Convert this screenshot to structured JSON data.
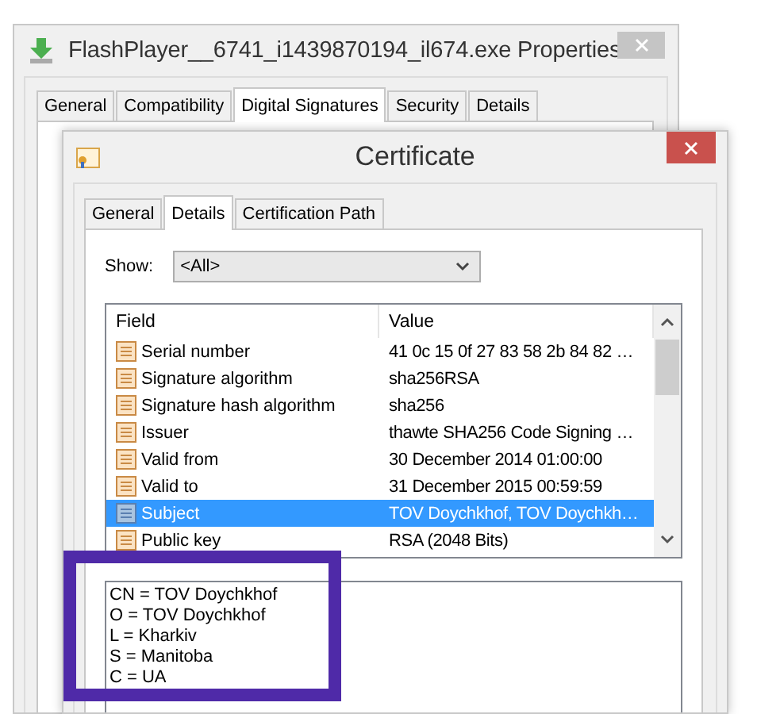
{
  "properties_window": {
    "title": "FlashPlayer__6741_i1439870194_il674.exe Properties",
    "tabs": [
      {
        "label": "General",
        "selected": false
      },
      {
        "label": "Compatibility",
        "selected": false
      },
      {
        "label": "Digital Signatures",
        "selected": true
      },
      {
        "label": "Security",
        "selected": false
      },
      {
        "label": "Details",
        "selected": false
      }
    ]
  },
  "certificate_window": {
    "title": "Certificate",
    "tabs": [
      {
        "label": "General",
        "selected": false
      },
      {
        "label": "Details",
        "selected": true
      },
      {
        "label": "Certification Path",
        "selected": false
      }
    ],
    "show": {
      "label": "Show:",
      "value": "<All>"
    },
    "table": {
      "columns": [
        "Field",
        "Value"
      ],
      "rows": [
        {
          "field": "Serial number",
          "value": "41 0c 15 0f 27 83 58 2b 84 82 …",
          "selected": false
        },
        {
          "field": "Signature algorithm",
          "value": "sha256RSA",
          "selected": false
        },
        {
          "field": "Signature hash algorithm",
          "value": "sha256",
          "selected": false
        },
        {
          "field": "Issuer",
          "value": "thawte SHA256 Code Signing …",
          "selected": false
        },
        {
          "field": "Valid from",
          "value": "30 December 2014 01:00:00",
          "selected": false
        },
        {
          "field": "Valid to",
          "value": "31 December 2015 00:59:59",
          "selected": false
        },
        {
          "field": "Subject",
          "value": "TOV Doychkhof, TOV Doychkh…",
          "selected": true
        },
        {
          "field": "Public key",
          "value": "RSA (2048 Bits)",
          "selected": false
        }
      ]
    },
    "detail_lines": [
      "CN = TOV Doychkhof",
      "O = TOV Doychkhof",
      "L = Kharkiv",
      "S = Manitoba",
      "C = UA"
    ]
  }
}
